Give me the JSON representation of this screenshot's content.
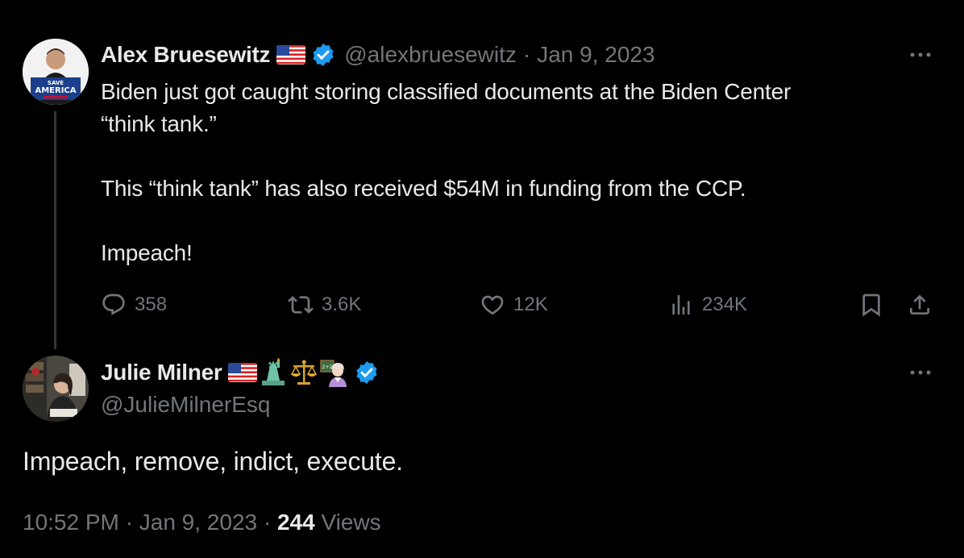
{
  "parent_tweet": {
    "display_name": "Alex Bruesewitz",
    "handle": "@alexbruesewitz",
    "separator": "·",
    "date": "Jan 9, 2023",
    "avatar_text_top": "SAVE",
    "avatar_text_main": "AMERICA",
    "text_lines": [
      "Biden just got caught storing classified  documents at the Biden Center",
      "“think tank.”",
      "",
      "This “think tank” has also received $54M in funding from the CCP.",
      "",
      "Impeach!"
    ],
    "stats": {
      "replies": "358",
      "retweets": "3.6K",
      "likes": "12K",
      "views": "234K"
    }
  },
  "reply_tweet": {
    "display_name": "Julie Milner",
    "handle": "@JulieMilnerEsq",
    "text": "Impeach, remove, indict, execute.",
    "time": "10:52 PM",
    "separator": "·",
    "date": "Jan 9, 2023",
    "views_count": "244",
    "views_label": "Views"
  },
  "colors": {
    "background": "#000000",
    "primary_text": "#e7e9ea",
    "secondary_text": "#71767b",
    "verified_blue": "#1d9bf0",
    "thread_line": "#333639"
  },
  "icons": [
    "reply-icon",
    "retweet-icon",
    "like-icon",
    "views-icon",
    "bookmark-icon",
    "share-icon",
    "more-icon",
    "verified-badge-icon",
    "us-flag-icon",
    "statue-of-liberty-emoji",
    "scales-emoji",
    "teacher-emoji"
  ]
}
